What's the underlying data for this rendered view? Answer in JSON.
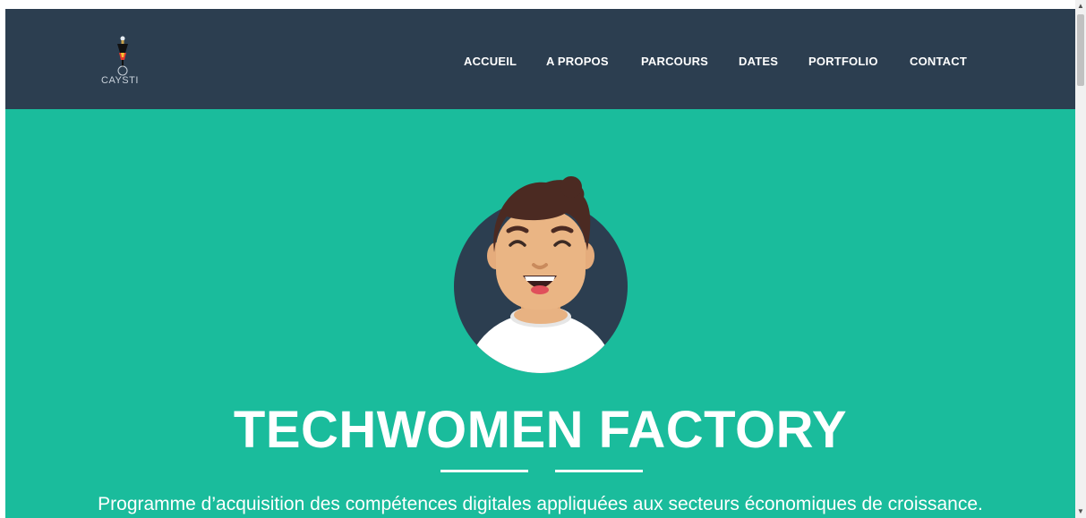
{
  "brand": {
    "logo_text": "CAYSTI"
  },
  "nav": {
    "items": [
      {
        "label": "ACCUEIL"
      },
      {
        "label": "A PROPOS"
      },
      {
        "label": "PARCOURS"
      },
      {
        "label": "DATES"
      },
      {
        "label": "PORTFOLIO"
      },
      {
        "label": "CONTACT"
      }
    ]
  },
  "hero": {
    "title": "TECHWOMEN FACTORY",
    "subtitle": "Programme d’acquisition des compétences digitales appliquées aux secteurs économiques de croissance.",
    "avatar_icon": "avatar-illustration"
  },
  "colors": {
    "navbar": "#2c3e50",
    "hero_bg": "#1abc9c",
    "text": "#ffffff"
  },
  "scrollbar": {
    "up_icon": "scroll-up-icon",
    "down_icon": "scroll-down-icon"
  }
}
